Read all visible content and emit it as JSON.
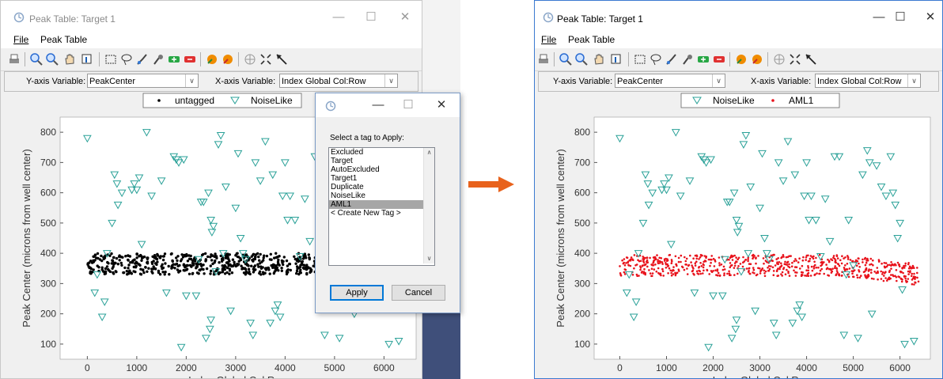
{
  "left_window": {
    "title": "Peak Table: Target 1",
    "menu": [
      "File",
      "Peak Table"
    ],
    "y_label": "Y-axis Variable:",
    "y_value": "PeakCenter",
    "x_label": "X-axis Variable:",
    "x_value": "Index Global Col:Row",
    "legend": [
      "untagged",
      "NoiseLike"
    ]
  },
  "right_window": {
    "title": "Peak Table: Target 1",
    "menu": [
      "File",
      "Peak Table"
    ],
    "y_label": "Y-axis Variable:",
    "y_value": "PeakCenter",
    "x_label": "X-axis Variable:",
    "x_value": "Index Global Col:Row",
    "legend": [
      "NoiseLike",
      "AML1"
    ]
  },
  "dialog": {
    "prompt": "Select a tag to Apply:",
    "options": [
      "Excluded",
      "Target",
      "AutoExcluded",
      "Target1",
      "Duplicate",
      "NoiseLike",
      "AML1",
      "< Create New Tag >"
    ],
    "selected": "AML1",
    "apply": "Apply",
    "cancel": "Cancel"
  },
  "colors": {
    "noise": "#2aa198",
    "untagged": "#000000",
    "aml1": "#e8121b",
    "arrow": "#e8621c",
    "selection": "#a6a6a6"
  },
  "chart_data": [
    {
      "type": "scatter",
      "xlabel": "Index Global Col:Row",
      "ylabel": "Peak Center (microns from well center)",
      "x_ticks": [
        0,
        1000,
        2000,
        3000,
        4000,
        5000,
        6000
      ],
      "y_ticks": [
        100,
        200,
        300,
        400,
        500,
        600,
        700,
        800
      ],
      "series": [
        {
          "name": "untagged",
          "marker": "dot",
          "color": "#000000",
          "band": {
            "x": [
              0,
              4800
            ],
            "y_center": 365,
            "y_spread": 35
          }
        },
        {
          "name": "NoiseLike",
          "marker": "triangle-down",
          "color": "#2aa198"
        }
      ]
    },
    {
      "type": "scatter",
      "xlabel": "Index Global Col:Row",
      "ylabel": "Peak Center (microns from well center)",
      "x_ticks": [
        0,
        1000,
        2000,
        3000,
        4000,
        5000,
        6000
      ],
      "y_ticks": [
        100,
        200,
        300,
        400,
        500,
        600,
        700,
        800
      ],
      "series": [
        {
          "name": "NoiseLike",
          "marker": "triangle-down",
          "color": "#2aa198"
        },
        {
          "name": "AML1",
          "marker": "dot",
          "color": "#e8121b",
          "band": {
            "x": [
              0,
              6400
            ],
            "y_center": 360,
            "y_spread": 35
          }
        }
      ]
    }
  ],
  "noise_points": [
    [
      0,
      780
    ],
    [
      150,
      270
    ],
    [
      200,
      330
    ],
    [
      300,
      190
    ],
    [
      350,
      240
    ],
    [
      400,
      400
    ],
    [
      500,
      500
    ],
    [
      550,
      660
    ],
    [
      600,
      630
    ],
    [
      620,
      560
    ],
    [
      700,
      600
    ],
    [
      900,
      610
    ],
    [
      950,
      630
    ],
    [
      1000,
      610
    ],
    [
      1050,
      650
    ],
    [
      1100,
      430
    ],
    [
      1200,
      800
    ],
    [
      1300,
      590
    ],
    [
      1500,
      640
    ],
    [
      1600,
      270
    ],
    [
      1750,
      720
    ],
    [
      1800,
      710
    ],
    [
      1850,
      700
    ],
    [
      1900,
      90
    ],
    [
      1950,
      710
    ],
    [
      2000,
      260
    ],
    [
      2200,
      260
    ],
    [
      2250,
      380
    ],
    [
      2300,
      570
    ],
    [
      2350,
      570
    ],
    [
      2400,
      120
    ],
    [
      2450,
      600
    ],
    [
      2480,
      150
    ],
    [
      2500,
      180
    ],
    [
      2500,
      510
    ],
    [
      2520,
      470
    ],
    [
      2550,
      490
    ],
    [
      2600,
      340
    ],
    [
      2650,
      760
    ],
    [
      2700,
      790
    ],
    [
      2750,
      400
    ],
    [
      2800,
      620
    ],
    [
      2900,
      210
    ],
    [
      3000,
      550
    ],
    [
      3050,
      730
    ],
    [
      3100,
      450
    ],
    [
      3150,
      400
    ],
    [
      3200,
      380
    ],
    [
      3300,
      170
    ],
    [
      3350,
      130
    ],
    [
      3400,
      700
    ],
    [
      3500,
      640
    ],
    [
      3600,
      770
    ],
    [
      3700,
      170
    ],
    [
      3750,
      660
    ],
    [
      3800,
      210
    ],
    [
      3850,
      230
    ],
    [
      3900,
      190
    ],
    [
      3950,
      590
    ],
    [
      4000,
      700
    ],
    [
      4050,
      510
    ],
    [
      4100,
      590
    ],
    [
      4200,
      510
    ],
    [
      4300,
      390
    ],
    [
      4400,
      580
    ],
    [
      4500,
      440
    ],
    [
      4600,
      720
    ],
    [
      4700,
      720
    ],
    [
      4800,
      130
    ],
    [
      4850,
      330
    ],
    [
      4900,
      510
    ],
    [
      5000,
      360
    ],
    [
      5100,
      120
    ],
    [
      5200,
      660
    ],
    [
      5300,
      740
    ],
    [
      5350,
      700
    ],
    [
      5400,
      200
    ],
    [
      5500,
      690
    ],
    [
      5600,
      620
    ],
    [
      5700,
      590
    ],
    [
      5800,
      720
    ],
    [
      5850,
      600
    ],
    [
      5900,
      560
    ],
    [
      5950,
      450
    ],
    [
      6000,
      500
    ],
    [
      6050,
      280
    ],
    [
      6100,
      100
    ],
    [
      6300,
      110
    ]
  ]
}
